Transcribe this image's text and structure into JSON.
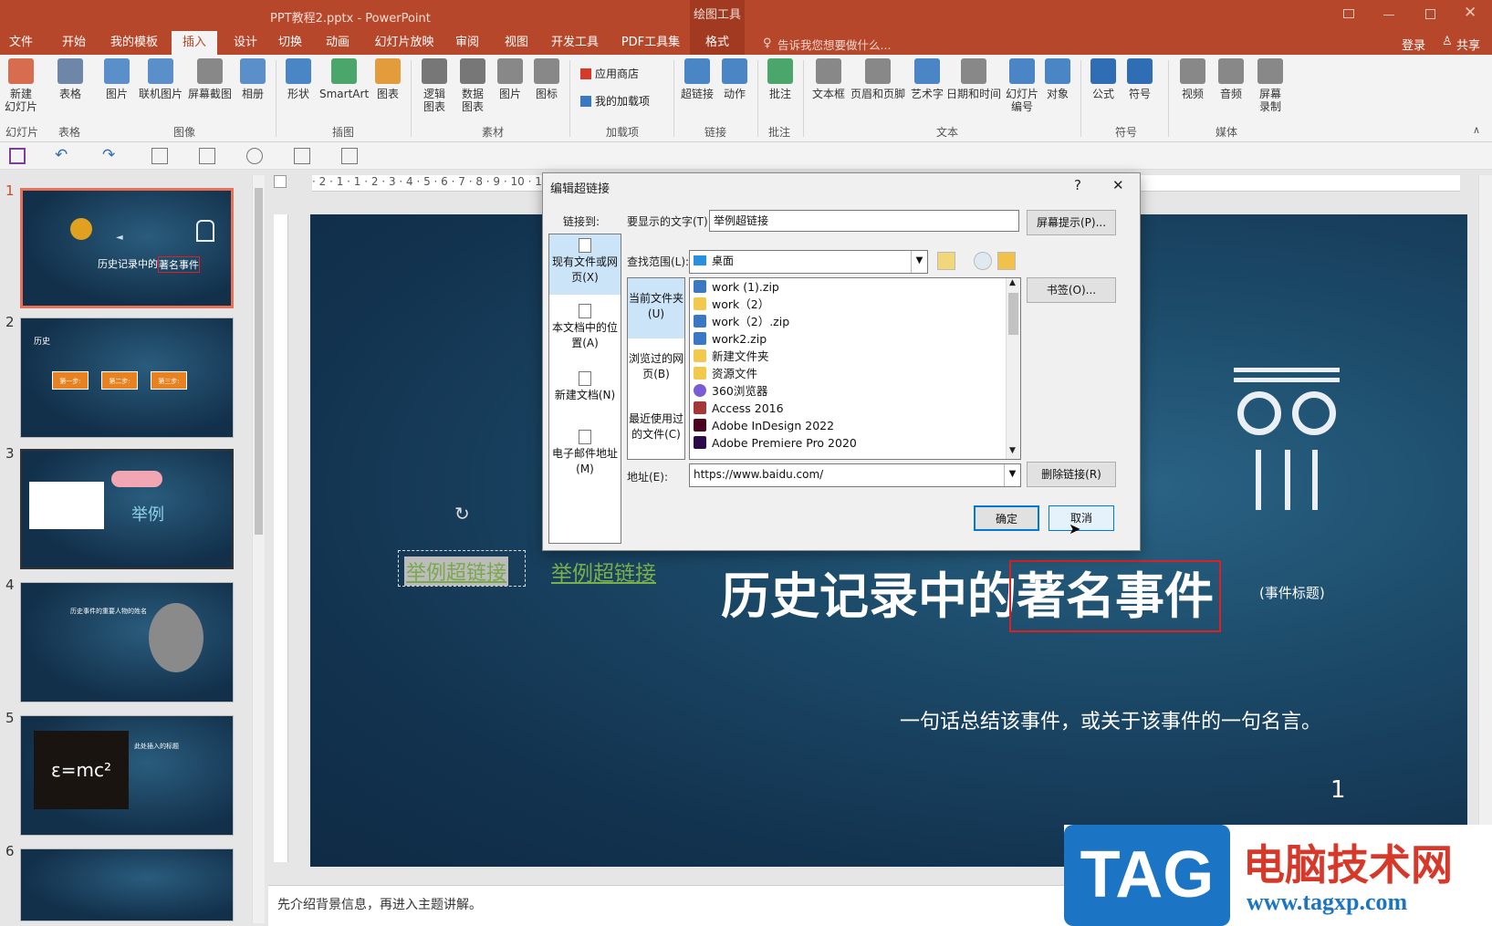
{
  "window": {
    "title": "PPT教程2.pptx - PowerPoint",
    "context_tab": "绘图工具"
  },
  "tabs": [
    "文件",
    "开始",
    "我的模板",
    "插入",
    "设计",
    "切换",
    "动画",
    "幻灯片放映",
    "审阅",
    "视图",
    "开发工具",
    "PDF工具集",
    "格式"
  ],
  "tell_me": "告诉我您想要做什么...",
  "login": "登录",
  "share": "共享",
  "ribbon": {
    "buttons": [
      {
        "label": "新建\n幻灯片",
        "color": "#d86c4f"
      },
      {
        "label": "表格",
        "color": "#6e87a8"
      },
      {
        "label": "图片",
        "color": "#5b8fc9"
      },
      {
        "label": "联机图片",
        "color": "#5b8fc9"
      },
      {
        "label": "屏幕截图",
        "color": "#777777"
      },
      {
        "label": "相册",
        "color": "#5b8fc9"
      },
      {
        "label": "形状",
        "color": "#4a86c5"
      },
      {
        "label": "SmartArt",
        "color": "#4aa66a"
      },
      {
        "label": "图表",
        "color": "#e39c3c"
      },
      {
        "label": "逻辑\n图表",
        "color": "#666666"
      },
      {
        "label": "数据\n图表",
        "color": "#666666"
      },
      {
        "label": "图片",
        "color": "#777777"
      },
      {
        "label": "图标",
        "color": "#777777"
      },
      {
        "label": "超链接",
        "color": "#4a86c5"
      },
      {
        "label": "动作",
        "color": "#4a86c5"
      },
      {
        "label": "批注",
        "color": "#4aa66a"
      },
      {
        "label": "文本框",
        "color": "#777777"
      },
      {
        "label": "页眉和页脚",
        "color": "#777777"
      },
      {
        "label": "艺术字",
        "color": "#4a86c5"
      },
      {
        "label": "日期和时间",
        "color": "#777777"
      },
      {
        "label": "幻灯片\n编号",
        "color": "#4a86c5"
      },
      {
        "label": "对象",
        "color": "#4a86c5"
      },
      {
        "label": "公式",
        "color": "#2f6db5"
      },
      {
        "label": "符号",
        "color": "#2f6db5"
      },
      {
        "label": "视频",
        "color": "#777777"
      },
      {
        "label": "音频",
        "color": "#777777"
      },
      {
        "label": "屏幕\n录制",
        "color": "#777777"
      }
    ],
    "addins": {
      "store": "应用商店",
      "mine": "我的加载项"
    },
    "groups": [
      "幻灯片",
      "表格",
      "图像",
      "插图",
      "素材",
      "加载项",
      "链接",
      "批注",
      "文本",
      "符号",
      "媒体"
    ]
  },
  "ruler_text": "· 2 · 1 · 1 · 2 · 3 · 4 · 5 · 6 · 7 · 8 · 9 · 10 · 11 · 12 · 13 · 14 · 15 · 16 · 17 · 18 · 19 · 20 · 21 · 22 · 23 · 24 · 25 · 26 · 27 · 28 · 29 · 30 · 31 · 32 ·",
  "slides": [
    {
      "n": "1"
    },
    {
      "n": "2",
      "title": "历史",
      "steps": [
        "第一步:",
        "第二步:",
        "第三步:"
      ]
    },
    {
      "n": "3",
      "label": "举例"
    },
    {
      "n": "4",
      "title": "历史事件的重要人物的姓名"
    },
    {
      "n": "5",
      "formula": "ε=mc²",
      "title": "此处插入的标题"
    },
    {
      "n": "6"
    }
  ],
  "slide": {
    "title_part1": "历史记录中的",
    "title_part2": "著名事件",
    "title_note": "(事件标题)",
    "subtitle": "一句话总结该事件，或关于该事件的一句名言。",
    "page": "1",
    "hyperlink": "举例超链接",
    "selected_text": "举例超链接"
  },
  "notes": "先介绍背景信息，再进入主题讲解。",
  "dialog": {
    "title": "编辑超链接",
    "help": "?",
    "close": "✕",
    "link_to": "链接到:",
    "nav": [
      "现有文件或网页(X)",
      "本文档中的位置(A)",
      "新建文档(N)",
      "电子邮件地址(M)"
    ],
    "display_label": "要显示的文字(T):",
    "display_value": "举例超链接",
    "screentip": "屏幕提示(P)...",
    "lookin_label": "查找范围(L):",
    "lookin_value": "桌面",
    "bookmark": "书签(O)...",
    "left_tabs": [
      "当前文件夹(U)",
      "浏览过的网页(B)",
      "最近使用过的文件(C)"
    ],
    "files": [
      {
        "name": "work (1).zip",
        "color": "#3b78c4"
      },
      {
        "name": "work（2）",
        "color": "#f2c94c"
      },
      {
        "name": "work（2）.zip",
        "color": "#3b78c4"
      },
      {
        "name": "work2.zip",
        "color": "#3b78c4"
      },
      {
        "name": "新建文件夹",
        "color": "#f2c94c"
      },
      {
        "name": "资源文件",
        "color": "#f2c94c"
      },
      {
        "name": "360浏览器",
        "color": "#7b5bd6"
      },
      {
        "name": "Access 2016",
        "color": "#a4373a"
      },
      {
        "name": "Adobe InDesign 2022",
        "color": "#49021f"
      },
      {
        "name": "Adobe Premiere Pro 2020",
        "color": "#2a0a4a"
      }
    ],
    "address_label": "地址(E):",
    "address_value": "https://www.baidu.com/",
    "remove_link": "删除链接(R)",
    "ok": "确定",
    "cancel": "取消"
  },
  "watermark": {
    "tag": "TAG",
    "site": "电脑技术网",
    "url": "www.tagxp.com"
  }
}
